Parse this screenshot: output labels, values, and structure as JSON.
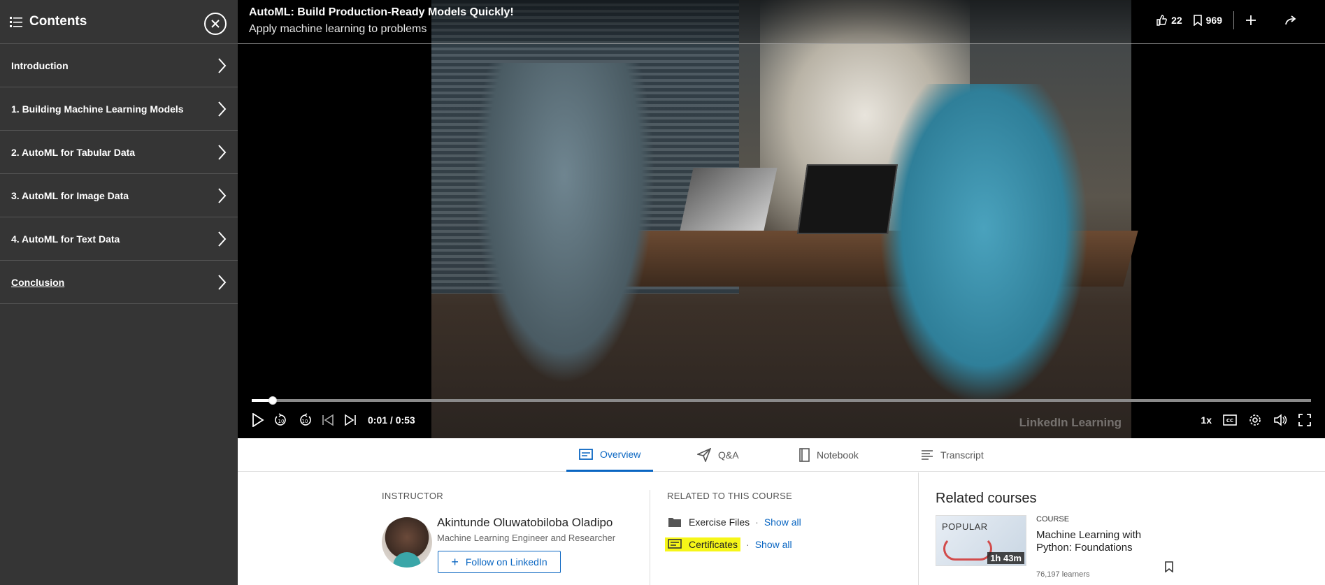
{
  "sidebar": {
    "title": "Contents",
    "chapters": [
      {
        "label": "Introduction"
      },
      {
        "label": "1. Building Machine Learning Models"
      },
      {
        "label": "2. AutoML for Tabular Data"
      },
      {
        "label": "3. AutoML for Image Data"
      },
      {
        "label": "4. AutoML for Text Data"
      },
      {
        "label": "Conclusion"
      }
    ]
  },
  "video": {
    "title": "AutoML: Build Production-Ready Models Quickly!",
    "subtitle": "Apply machine learning to problems",
    "likes": "22",
    "saves": "969",
    "time": "0:01 / 0:53",
    "progress_fraction": 0.02,
    "speed": "1x",
    "watermark": "LinkedIn Learning"
  },
  "tabs": [
    {
      "label": "Overview",
      "icon": "overview-icon",
      "active": true
    },
    {
      "label": "Q&A",
      "icon": "paper-plane-icon"
    },
    {
      "label": "Notebook",
      "icon": "notebook-icon"
    },
    {
      "label": "Transcript",
      "icon": "transcript-icon"
    }
  ],
  "instructor": {
    "section_label": "INSTRUCTOR",
    "name": "Akintunde Oluwatobiloba Oladipo",
    "title": "Machine Learning Engineer and Researcher",
    "follow_label": "Follow on LinkedIn"
  },
  "related_to_course": {
    "section_label": "RELATED TO THIS COURSE",
    "items": [
      {
        "label": "Exercise Files",
        "link": "Show all",
        "icon": "folder-icon"
      },
      {
        "label": "Certificates",
        "link": "Show all",
        "icon": "certificate-icon"
      }
    ]
  },
  "related_courses": {
    "title": "Related courses",
    "course": {
      "badge": "POPULAR",
      "duration": "1h 43m",
      "type": "COURSE",
      "name": "Machine Learning with Python: Foundations",
      "learners": "76,197 learners"
    }
  },
  "colors": {
    "accent": "#0a66c2",
    "sidebar_bg": "#353535",
    "highlight": "#f6f618"
  }
}
